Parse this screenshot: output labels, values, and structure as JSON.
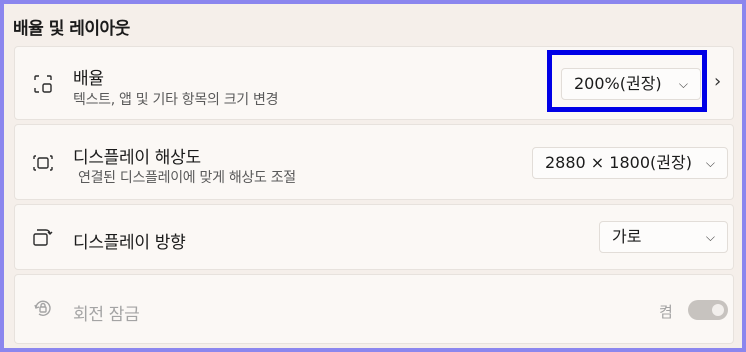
{
  "section": {
    "title": "배율 및 레이아웃"
  },
  "scale": {
    "icon": "scale-icon",
    "label": "배율",
    "description": "텍스트, 앱 및 기타 항목의 크기 변경",
    "value": "200%(권장)",
    "dropdown_icon": "chevron-down-icon",
    "nav_icon": "chevron-right-icon"
  },
  "resolution": {
    "icon": "display-resolution-icon",
    "label": "디스플레이 해상도",
    "description": "연결된 디스플레이에 맞게 해상도 조절",
    "value": "2880 × 1800(권장)",
    "dropdown_icon": "chevron-down-icon"
  },
  "orientation": {
    "icon": "display-orientation-icon",
    "label": "디스플레이 방향",
    "value": "가로",
    "dropdown_icon": "chevron-down-icon"
  },
  "rotation_lock": {
    "icon": "rotation-lock-icon",
    "label": "회전 잠금",
    "state_label": "켬",
    "enabled": false,
    "toggle_on": true
  },
  "colors": {
    "frame_border": "#8b86ee",
    "highlight": "#0000e6",
    "background": "#f5efea",
    "card": "#fbf8f5"
  }
}
